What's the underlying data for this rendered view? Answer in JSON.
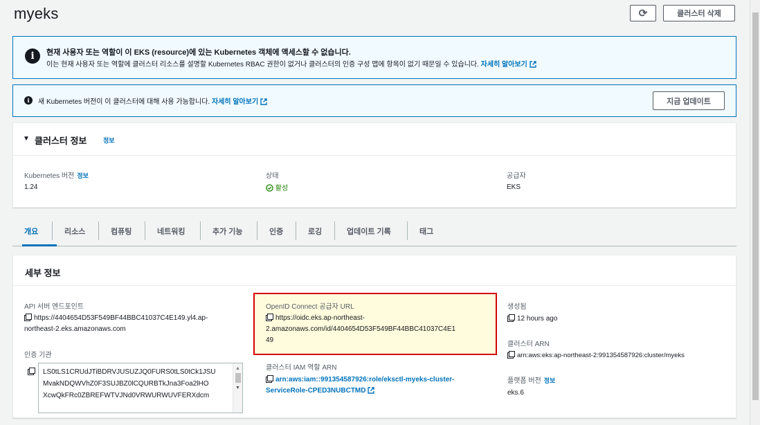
{
  "header": {
    "title": "myeks",
    "refresh_icon": "⟳",
    "delete_label": "클러스터 삭제"
  },
  "alert_access": {
    "title": "현재 사용자 또는 역할이 이 EKS (resource)에 있는 Kubernetes 객체에 액세스할 수 없습니다.",
    "body": "이는 현재 사용자 또는 역할에 클러스터 리소스를 설명할 Kubernetes RBAC 권한이 없거나 클러스터의 인증 구성 맵에 항목이 없기 때문일 수 있습니다.",
    "link": "자세히 알아보기"
  },
  "alert_version": {
    "text": "새 Kubernetes 버전이 이 클러스터에 대해 사용 가능합니다.",
    "link": "자세히 알아보기",
    "button": "지금 업데이트"
  },
  "cluster_info": {
    "title": "클러스터 정보",
    "info_link": "정보",
    "k8s_version_label": "Kubernetes 버전",
    "k8s_version_info": "정보",
    "k8s_version": "1.24",
    "status_label": "상태",
    "status": "활성",
    "provider_label": "공급자",
    "provider": "EKS"
  },
  "tabs": [
    "개요",
    "리소스",
    "컴퓨팅",
    "네트워킹",
    "추가 기능",
    "인증",
    "로깅",
    "업데이트 기록",
    "태그"
  ],
  "details": {
    "title": "세부 정보",
    "api_endpoint_label": "API 서버 엔드포인트",
    "api_endpoint_1": "https://4404654D53F549BF44BBC41037C4E149.yl4.ap-",
    "api_endpoint_2": "northeast-2.eks.amazonaws.com",
    "cert_label": "인증 기관",
    "cert_1": "LS0tLS1CRUdJTiBDRVJUSUZJQ0FURS0tLS0tCk1JSU",
    "cert_2": "MvakNDQWVhZ0F3SUJBZ0lCQURBTkJna3Foa2lHO",
    "cert_3": "XcwQkFRc0ZBREFWTVJNd0VRWURWUVFERXdcm",
    "oidc_label": "OpenID Connect 공급자 URL",
    "oidc_1": "https://oidc.eks.ap-northeast-",
    "oidc_2": "2.amazonaws.com/id/4404654D53F549BF44BBC41037C4E1",
    "oidc_3": "49",
    "iam_role_label": "클러스터 IAM 역할 ARN",
    "iam_role_1": "arn:aws:iam::991354587926:role/eksctl-myeks-cluster-",
    "iam_role_2": "ServiceRole-CPED3NUBCTMD",
    "created_label": "생성됨",
    "created": "12 hours ago",
    "cluster_arn_label": "클러스터 ARN",
    "cluster_arn": "arn:aws:eks:ap-northeast-2:991354587926:cluster/myeks",
    "platform_label": "플랫폼 버전",
    "platform_info": "정보",
    "platform": "eks.6"
  }
}
